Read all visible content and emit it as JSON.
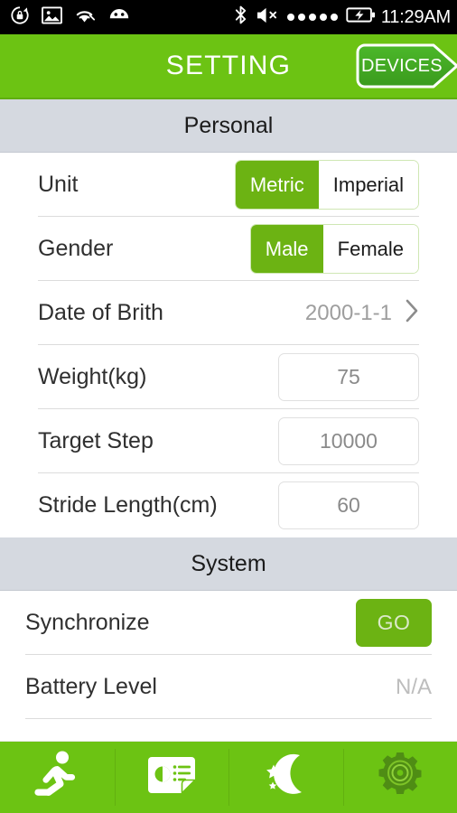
{
  "statusbar": {
    "time": "11:29AM",
    "left_icons": [
      "rotation-lock-icon",
      "screenshot-image-icon",
      "wifi-icon",
      "android-bugdroid-icon"
    ],
    "right_icons": [
      "bluetooth-icon",
      "volume-mute-icon",
      "signal-dots-icon",
      "battery-charging-icon"
    ],
    "signal_dots": 5,
    "background": "#000000"
  },
  "appbar": {
    "title": "SETTING",
    "devices_label": "DEVICES",
    "background": "#6cc313",
    "button_color": "#45ad24"
  },
  "sections": [
    {
      "id": "personal",
      "title": "Personal",
      "rows": [
        {
          "label": "Unit",
          "type": "segmented",
          "options": [
            "Metric",
            "Imperial"
          ],
          "selected": "Metric"
        },
        {
          "label": "Gender",
          "type": "segmented",
          "options": [
            "Male",
            "Female"
          ],
          "selected": "Male"
        },
        {
          "label": "Date of Brith",
          "type": "value-chevron",
          "value": "2000-1-1"
        },
        {
          "label": "Weight(kg)",
          "type": "input",
          "value": "75"
        },
        {
          "label": "Target Step",
          "type": "input",
          "value": "10000"
        },
        {
          "label": "Stride Length(cm)",
          "type": "input",
          "value": "60"
        }
      ]
    },
    {
      "id": "system",
      "title": "System",
      "rows": [
        {
          "label": "Synchronize",
          "type": "button",
          "value": "GO"
        },
        {
          "label": "Battery Level",
          "type": "text",
          "value": "N/A"
        }
      ]
    }
  ],
  "navbar": {
    "background": "#6cc313",
    "items": [
      {
        "icon": "running-person-icon",
        "active": false
      },
      {
        "icon": "report-card-icon",
        "active": false
      },
      {
        "icon": "moon-stars-sleep-icon",
        "active": false
      },
      {
        "icon": "gear-settings-icon",
        "active": true
      }
    ]
  },
  "colors": {
    "brand_green": "#6cc313",
    "selected_green": "#6cb313",
    "section_gray": "#d5d9e0",
    "muted_text": "#9e9e9e"
  }
}
